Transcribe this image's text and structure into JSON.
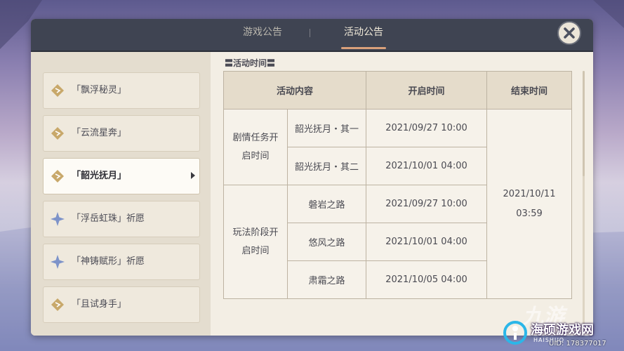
{
  "header": {
    "tabs": [
      {
        "label": "游戏公告",
        "active": false
      },
      {
        "label": "活动公告",
        "active": true
      }
    ]
  },
  "sidebar": {
    "items": [
      {
        "label": "「飘浮秘灵」",
        "icon": "gold-diamond-icon"
      },
      {
        "label": "「云流星奔」",
        "icon": "gold-diamond-icon"
      },
      {
        "label": "「韶光抚月」",
        "icon": "gold-diamond-icon",
        "active": true
      },
      {
        "label": "「浮岳虹珠」祈愿",
        "icon": "blue-star-icon"
      },
      {
        "label": "「神铸赋形」祈愿",
        "icon": "blue-star-icon"
      },
      {
        "label": "「且试身手」",
        "icon": "gold-diamond-icon"
      }
    ]
  },
  "content": {
    "section_title": "〓活动时间〓",
    "table": {
      "headers": [
        "活动内容",
        "开启时间",
        "结束时间"
      ],
      "groups": [
        {
          "name": "剧情任务开启时间",
          "rows": [
            {
              "item": "韶光抚月・其一",
              "start": "2021/09/27 10:00"
            },
            {
              "item": "韶光抚月・其二",
              "start": "2021/10/01 04:00"
            }
          ]
        },
        {
          "name": "玩法阶段开启时间",
          "rows": [
            {
              "item": "磐岩之路",
              "start": "2021/09/27 10:00"
            },
            {
              "item": "悠风之路",
              "start": "2021/10/01 04:00"
            },
            {
              "item": "肃霜之路",
              "start": "2021/10/05 04:00"
            }
          ]
        }
      ],
      "end_time": "2021/10/11 03:59"
    }
  },
  "watermark": {
    "big": "九游",
    "name": "海硕游戏网",
    "small": "HAISHUO",
    "uid": "UID: 178377017"
  },
  "colors": {
    "accent_underline": "#d9a07a",
    "topbar": "#3f4452",
    "panel": "#ece5d8",
    "gold_icon": "#c8a86a",
    "blue_icon": "#7d93c9"
  }
}
